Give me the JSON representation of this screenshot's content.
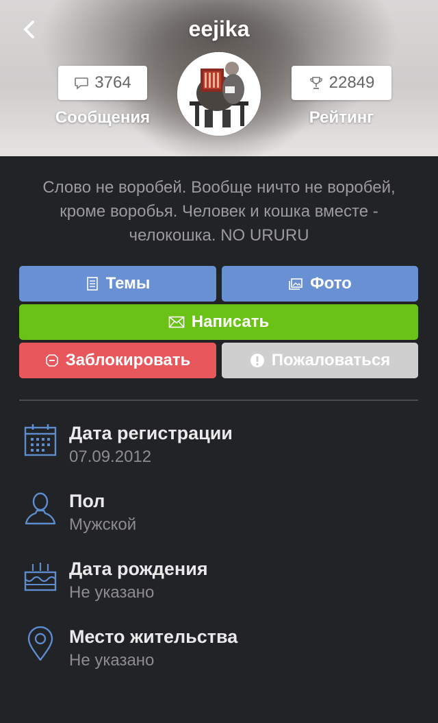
{
  "header": {
    "username": "eejika",
    "messages_count": "3764",
    "messages_label": "Сообщения",
    "rating_count": "22849",
    "rating_label": "Рейтинг"
  },
  "bio": {
    "line1": "Слово не воробей. Вообще ничто не воробей,",
    "line2": "кроме воробья.  Человек и кошка вместе -",
    "line3": "челокошка.  NO URURU"
  },
  "actions": {
    "topics": "Темы",
    "photo": "Фото",
    "write": "Написать",
    "block": "Заблокировать",
    "report": "Пожаловаться"
  },
  "info": [
    {
      "title": "Дата регистрации",
      "value": "07.09.2012",
      "icon": "calendar-icon"
    },
    {
      "title": "Пол",
      "value": "Мужской",
      "icon": "person-icon"
    },
    {
      "title": "Дата рождения",
      "value": "Не указано",
      "icon": "birthday-cake-icon"
    },
    {
      "title": "Место жительства",
      "value": "Не указано",
      "icon": "location-pin-icon"
    }
  ],
  "colors": {
    "background": "#222326",
    "primary_button": "#6990d3",
    "write_button": "#6bc217",
    "block_button": "#e8575c",
    "report_button": "#cfcfcf",
    "icon_blue": "#5d8ccf"
  }
}
